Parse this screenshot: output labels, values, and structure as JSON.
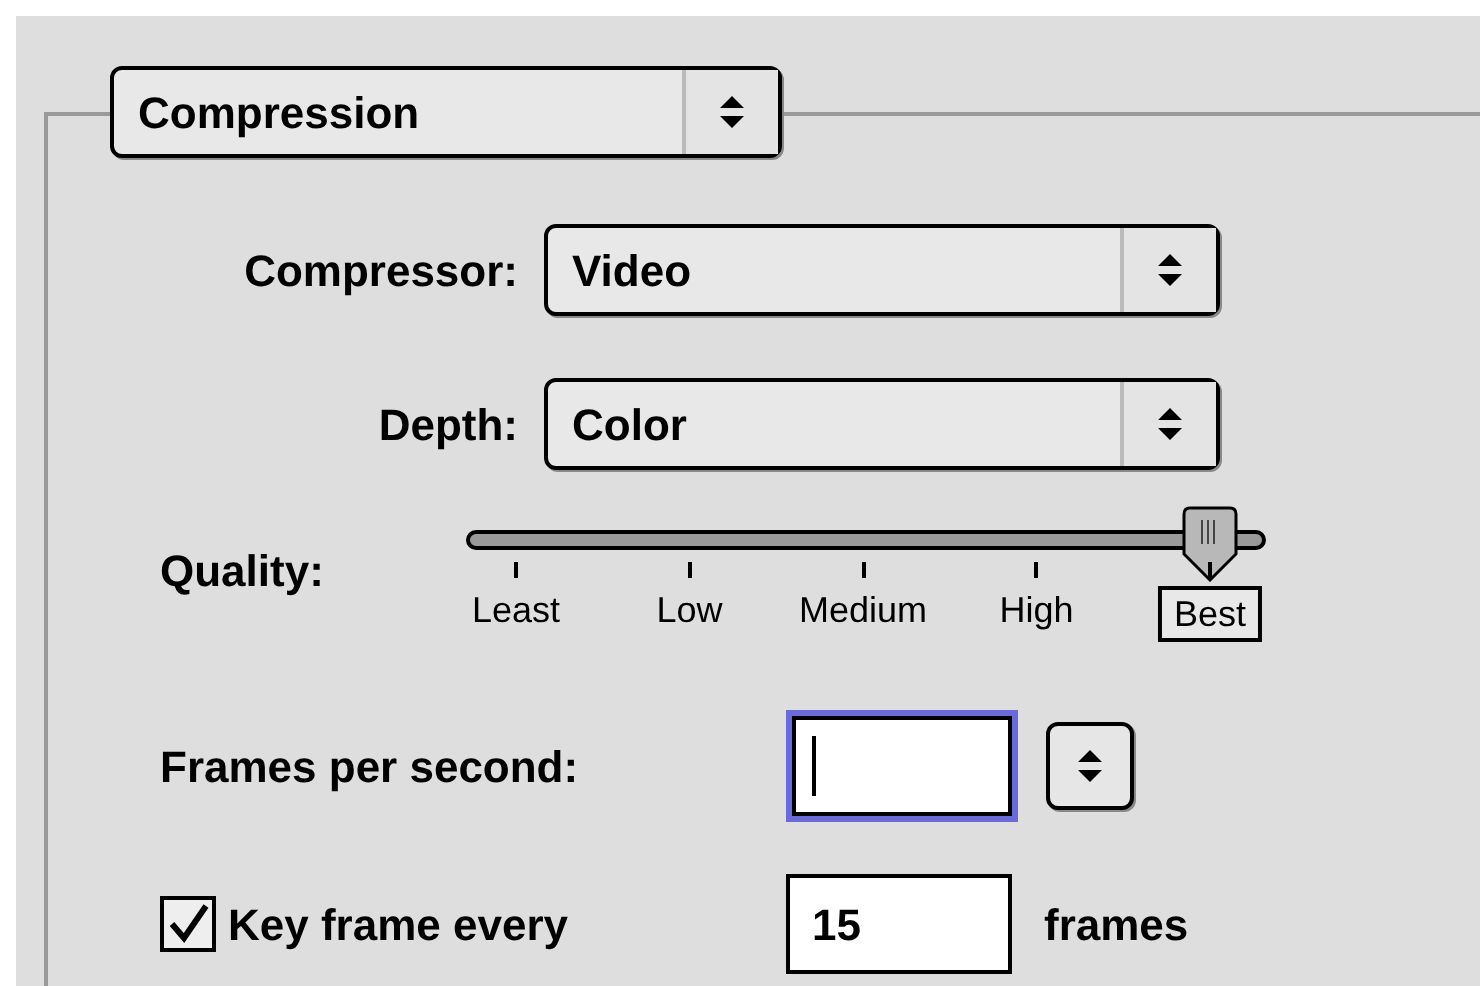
{
  "group_popup": {
    "value": "Compression"
  },
  "compressor": {
    "label": "Compressor:",
    "value": "Video"
  },
  "depth": {
    "label": "Depth:",
    "value": "Color"
  },
  "quality": {
    "label": "Quality:",
    "level": 1,
    "ticks": [
      {
        "label": "Least",
        "selected": false
      },
      {
        "label": "Low",
        "selected": false
      },
      {
        "label": "Medium",
        "selected": false
      },
      {
        "label": "High",
        "selected": false
      },
      {
        "label": "Best",
        "selected": true
      }
    ]
  },
  "frames_per_second": {
    "label": "Frames per second:",
    "focused": true
  },
  "key_frame": {
    "label": "Key frame every",
    "checked": true,
    "value": "15",
    "unit": "frames"
  }
}
